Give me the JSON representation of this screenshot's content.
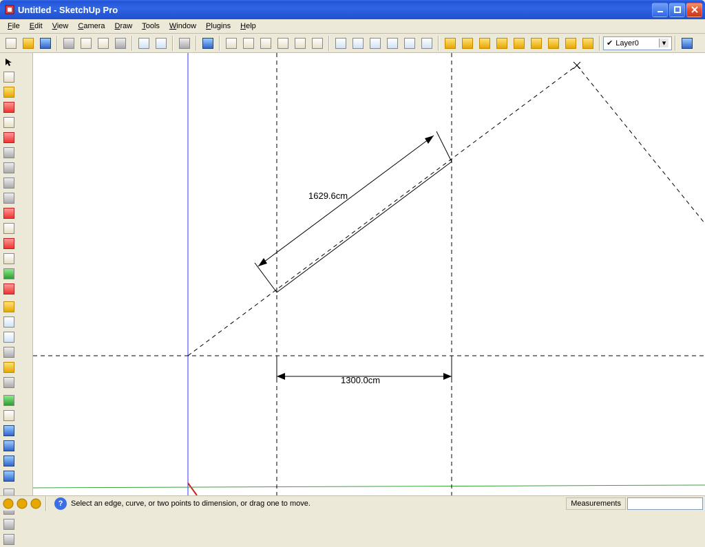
{
  "window": {
    "title": "Untitled - SketchUp Pro"
  },
  "menu": {
    "file": "File",
    "edit": "Edit",
    "view": "View",
    "camera": "Camera",
    "draw": "Draw",
    "tools": "Tools",
    "window": "Window",
    "plugins": "Plugins",
    "help": "Help"
  },
  "layer": {
    "selected": "Layer0"
  },
  "canvas": {
    "dim_diag": "1629.6cm",
    "dim_horiz": "1300.0cm"
  },
  "status": {
    "hint": "Select an edge, curve, or two points to dimension, or drag one to move.",
    "measure_label": "Measurements",
    "measure_value": ""
  }
}
